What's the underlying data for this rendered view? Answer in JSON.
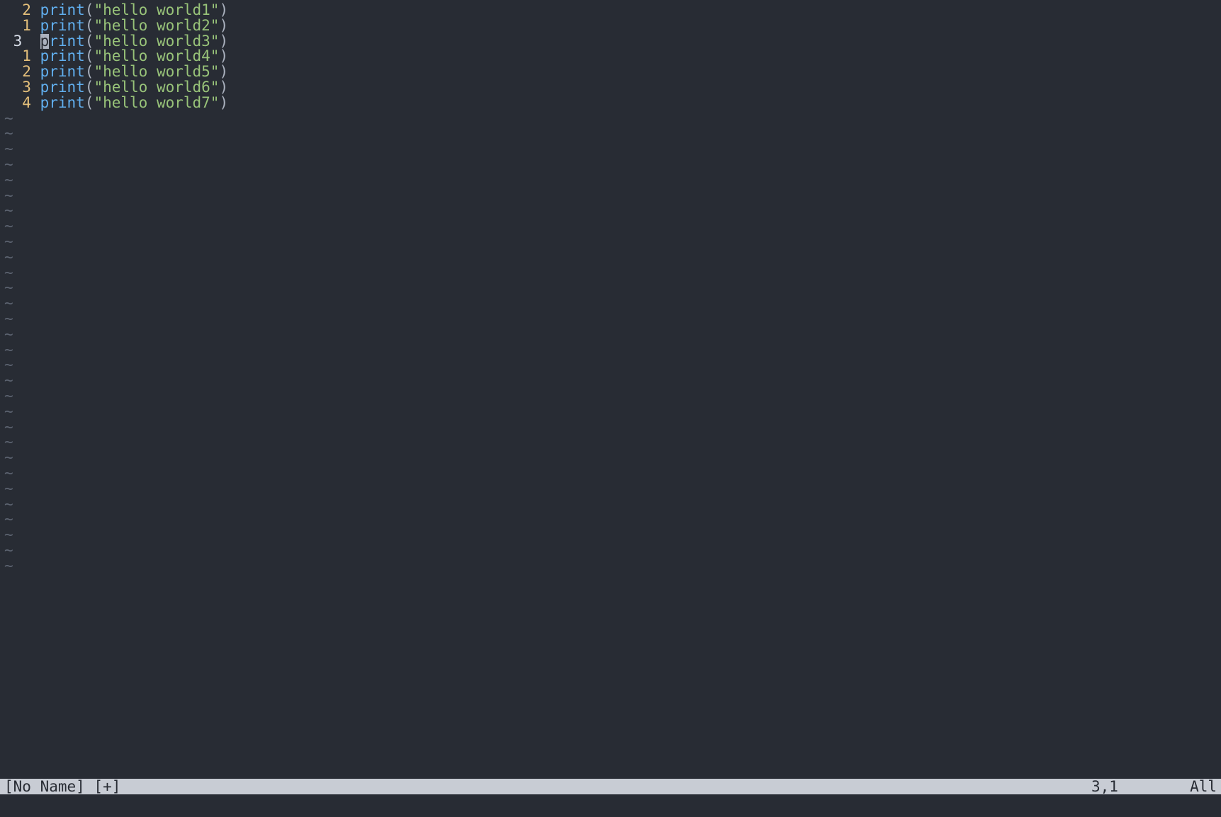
{
  "editor": {
    "lines": [
      {
        "num": "2",
        "abs": false,
        "text": "print(\"hello world1\")",
        "cursor_at": null
      },
      {
        "num": "1",
        "abs": false,
        "text": "print(\"hello world2\")",
        "cursor_at": null
      },
      {
        "num": "3 ",
        "abs": true,
        "text": "print(\"hello world3\")",
        "cursor_at": 0
      },
      {
        "num": "1",
        "abs": false,
        "text": "print(\"hello world4\")",
        "cursor_at": null
      },
      {
        "num": "2",
        "abs": false,
        "text": "print(\"hello world5\")",
        "cursor_at": null
      },
      {
        "num": "3",
        "abs": false,
        "text": "print(\"hello world6\")",
        "cursor_at": null
      },
      {
        "num": "4",
        "abs": false,
        "text": "print(\"hello world7\")",
        "cursor_at": null
      }
    ],
    "tilde_rows": 30,
    "tilde": "~"
  },
  "statusbar": {
    "left": "[No Name] [+]",
    "ruler": "3,1",
    "right": "All"
  }
}
